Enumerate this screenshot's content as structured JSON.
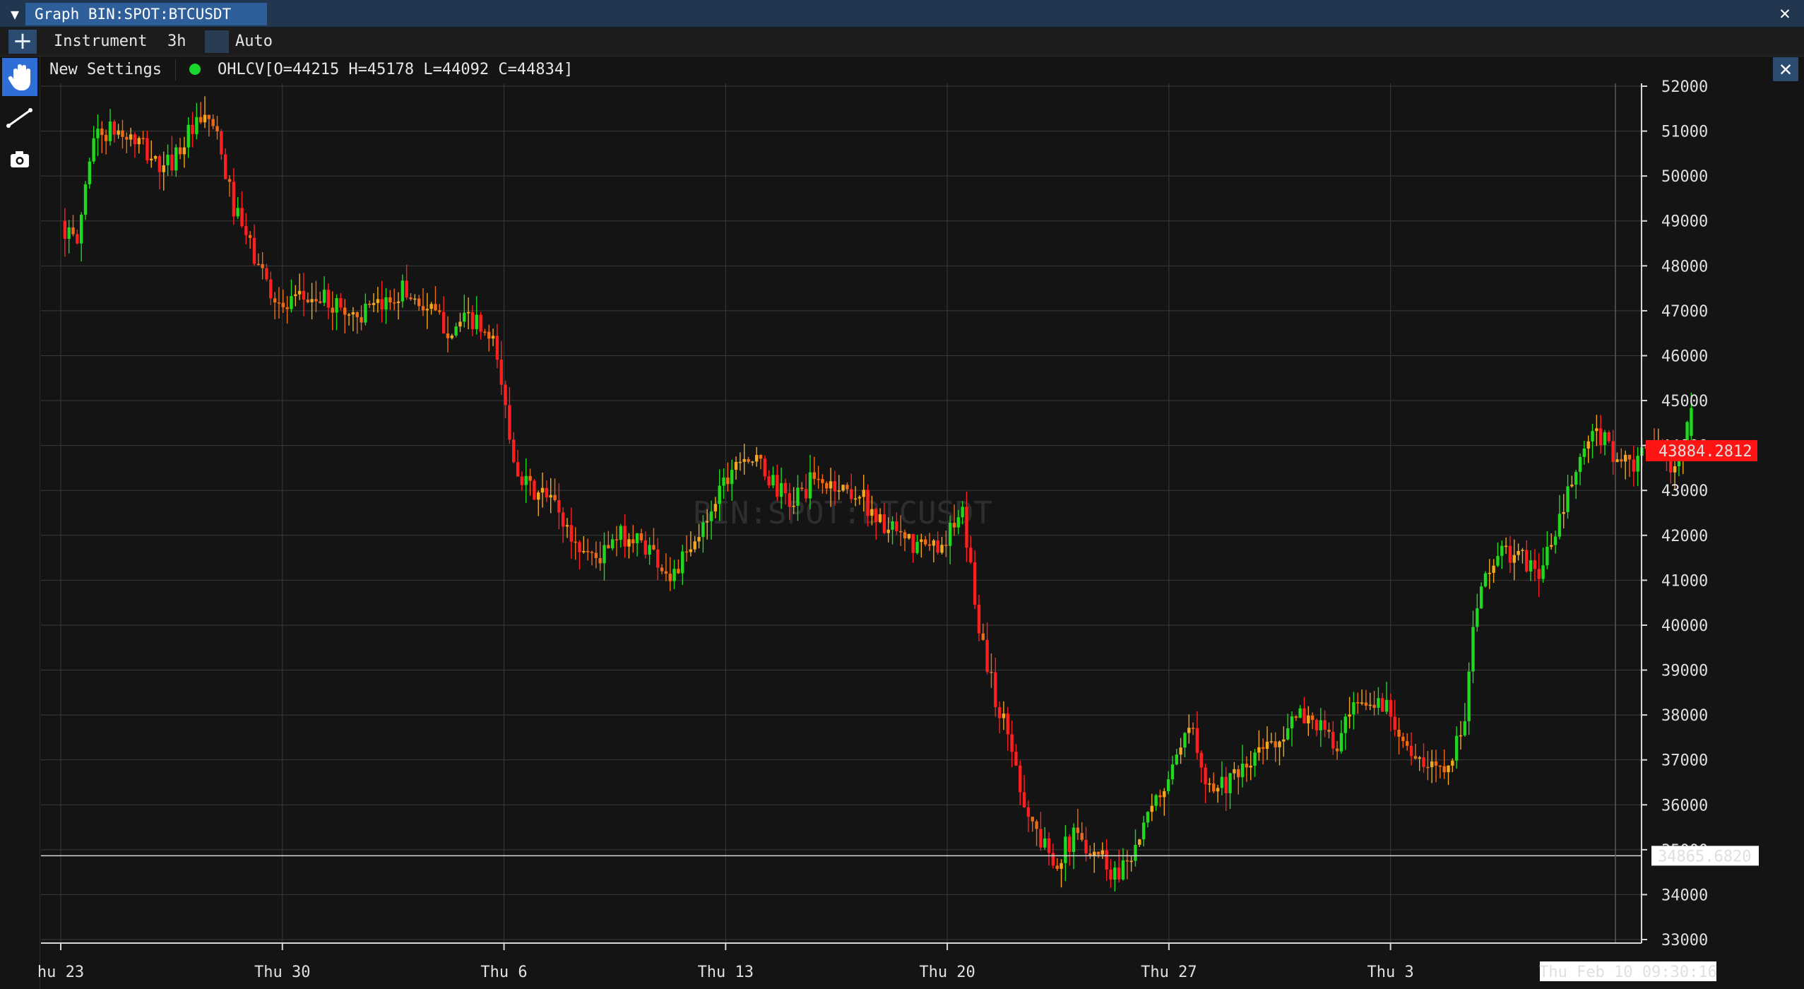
{
  "window": {
    "title": "Graph BIN:SPOT:BTCUSDT"
  },
  "toolbar": {
    "instrument_label": "Instrument",
    "interval_label": "3h",
    "auto_label": "Auto"
  },
  "indicator": {
    "menu_label": "New Settings",
    "text": "OHLCV[O=44215 H=45178 L=44092 C=44834]",
    "status_color": "#19d82d"
  },
  "icons": {
    "collapse": "triangle-down-icon",
    "add": "plus-icon",
    "close": "close-icon",
    "hand": "hand-icon",
    "line": "line-tool-icon",
    "camera": "camera-icon"
  },
  "colors": {
    "up": "#1fd81f",
    "down": "#ff1f1f",
    "mid_up": "#f4a81d",
    "mid_down": "#f06a16",
    "price_tag": "#ff1414",
    "grid": "#3a3a3a"
  },
  "chart_data": {
    "type": "candlestick",
    "watermark": "BIN:SPOT:BTCUSDT",
    "ylim": [
      33000,
      52000
    ],
    "yticks": [
      33000,
      34000,
      35000,
      36000,
      37000,
      38000,
      39000,
      40000,
      41000,
      42000,
      43000,
      44000,
      45000,
      46000,
      47000,
      48000,
      49000,
      50000,
      51000,
      52000
    ],
    "xticks": [
      {
        "label": "hu 23",
        "t": 0
      },
      {
        "label": "Thu 30",
        "t": 56
      },
      {
        "label": "Thu 6",
        "t": 112
      },
      {
        "label": "Thu 13",
        "t": 168
      },
      {
        "label": "Thu 20",
        "t": 224
      },
      {
        "label": "Thu 27",
        "t": 280
      },
      {
        "label": "Thu 3",
        "t": 336
      }
    ],
    "cursor_time_label": "Thu Feb 10 09:30:16",
    "current_price_label": "43884.2812",
    "crosshair_price_label": "34865.6820",
    "crosshair_price": 34865.682,
    "xlim": [
      -5,
      398
    ],
    "last_ohlc": {
      "open": 44215,
      "high": 45178,
      "low": 44092,
      "close": 44834
    },
    "path": [
      [
        0,
        49000
      ],
      [
        4,
        48400
      ],
      [
        8,
        50900
      ],
      [
        14,
        51000
      ],
      [
        20,
        50700
      ],
      [
        26,
        50100
      ],
      [
        32,
        50900
      ],
      [
        38,
        51300
      ],
      [
        44,
        49200
      ],
      [
        50,
        48000
      ],
      [
        56,
        47000
      ],
      [
        62,
        47300
      ],
      [
        68,
        47200
      ],
      [
        74,
        46900
      ],
      [
        80,
        47000
      ],
      [
        86,
        47500
      ],
      [
        92,
        47100
      ],
      [
        98,
        46600
      ],
      [
        104,
        46800
      ],
      [
        110,
        46100
      ],
      [
        114,
        43900
      ],
      [
        118,
        43000
      ],
      [
        124,
        42800
      ],
      [
        130,
        41800
      ],
      [
        136,
        41500
      ],
      [
        142,
        42000
      ],
      [
        148,
        41800
      ],
      [
        154,
        41100
      ],
      [
        160,
        41700
      ],
      [
        166,
        43000
      ],
      [
        172,
        43900
      ],
      [
        178,
        43400
      ],
      [
        184,
        42700
      ],
      [
        190,
        43200
      ],
      [
        196,
        43100
      ],
      [
        202,
        42900
      ],
      [
        208,
        42200
      ],
      [
        214,
        41800
      ],
      [
        220,
        41700
      ],
      [
        224,
        42000
      ],
      [
        228,
        42400
      ],
      [
        232,
        40000
      ],
      [
        236,
        38400
      ],
      [
        240,
        37400
      ],
      [
        244,
        35900
      ],
      [
        248,
        35100
      ],
      [
        252,
        34800
      ],
      [
        256,
        35300
      ],
      [
        260,
        35100
      ],
      [
        264,
        34800
      ],
      [
        266,
        34400
      ],
      [
        270,
        34900
      ],
      [
        274,
        35500
      ],
      [
        278,
        36300
      ],
      [
        282,
        36900
      ],
      [
        286,
        37800
      ],
      [
        290,
        36400
      ],
      [
        294,
        36500
      ],
      [
        298,
        36600
      ],
      [
        302,
        37100
      ],
      [
        306,
        37400
      ],
      [
        310,
        37700
      ],
      [
        314,
        38000
      ],
      [
        318,
        37800
      ],
      [
        322,
        37200
      ],
      [
        326,
        38000
      ],
      [
        330,
        38200
      ],
      [
        334,
        38300
      ],
      [
        338,
        37800
      ],
      [
        342,
        36900
      ],
      [
        346,
        36800
      ],
      [
        350,
        37000
      ],
      [
        354,
        37500
      ],
      [
        358,
        40600
      ],
      [
        362,
        41500
      ],
      [
        366,
        41600
      ],
      [
        370,
        41400
      ],
      [
        374,
        41200
      ],
      [
        378,
        42100
      ],
      [
        382,
        43200
      ],
      [
        386,
        44100
      ],
      [
        390,
        44200
      ],
      [
        394,
        43600
      ],
      [
        398,
        43500
      ],
      [
        402,
        44100
      ],
      [
        406,
        43600
      ],
      [
        410,
        43900
      ],
      [
        412,
        44830
      ]
    ],
    "candle_count": 396,
    "seed": 1337
  }
}
